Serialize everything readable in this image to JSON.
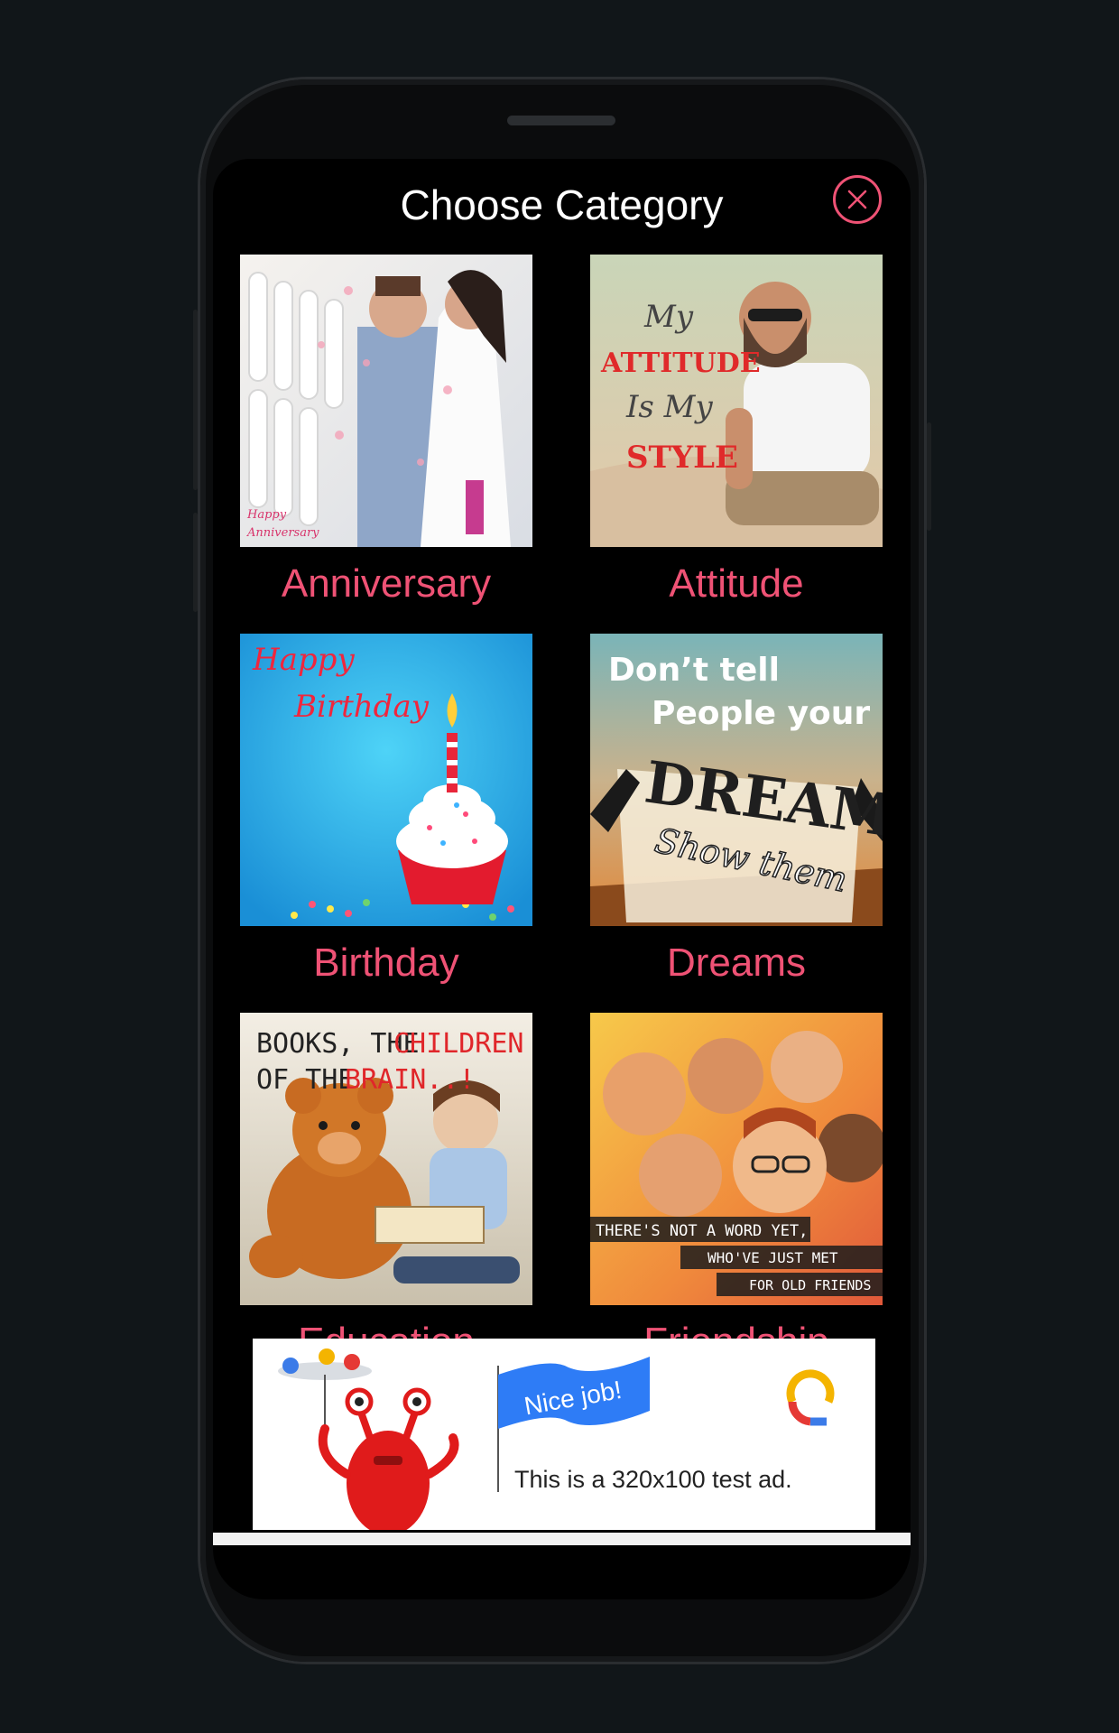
{
  "header": {
    "title": "Choose Category",
    "close_icon": "close-icon"
  },
  "categories": [
    {
      "label": "Anniversary",
      "image_text": [
        "Happy",
        "Anniversary"
      ]
    },
    {
      "label": "Attitude",
      "image_text": [
        "My",
        "ATTITUDE",
        "Is My",
        "STYLE"
      ]
    },
    {
      "label": "Birthday",
      "image_text": [
        "Happy",
        "Birthday"
      ]
    },
    {
      "label": "Dreams",
      "image_text": [
        "Don’t tell",
        "People your",
        "DREAM",
        "Show them"
      ]
    },
    {
      "label": "Education",
      "image_text": [
        "BOOKS, THE",
        "CHILDREN",
        "OF THE",
        "BRAIN..!"
      ]
    },
    {
      "label": "Friendship",
      "image_text": [
        "THERE'S NOT A WORD YET,",
        "WHO'VE JUST MET",
        "FOR OLD FRIENDS"
      ]
    }
  ],
  "ad": {
    "flag_text": "Nice job!",
    "body_text": "This is a 320x100 test ad."
  },
  "colors": {
    "accent": "#ef5275",
    "background": "#000000",
    "title": "#ffffff"
  }
}
